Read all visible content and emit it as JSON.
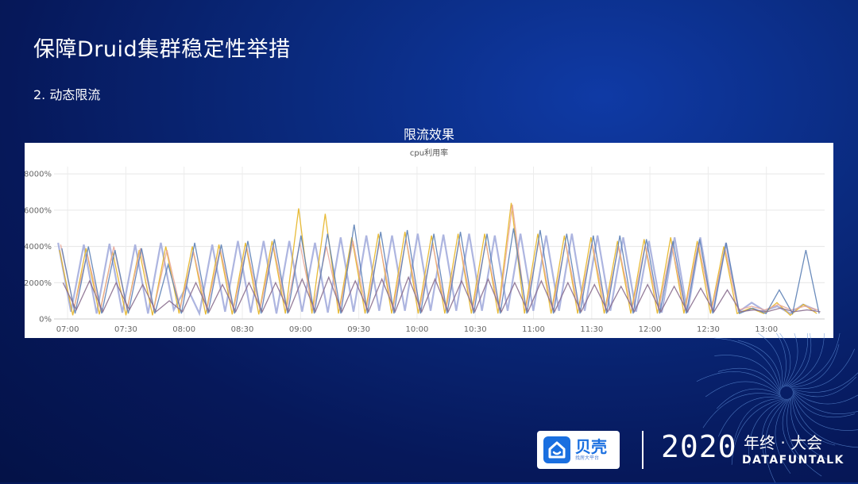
{
  "slide": {
    "title": "保障Druid集群稳定性举措",
    "subtitle": "2. 动态限流"
  },
  "chart_heading": "限流效果",
  "chart_data": {
    "type": "line",
    "title": "cpu利用率",
    "y_ticks": [
      "8000%",
      "6000%",
      "4000%",
      "2000%",
      "0%"
    ],
    "y_tick_values": [
      8000,
      6000,
      4000,
      2000,
      0
    ],
    "ylim": [
      0,
      8400
    ],
    "x_ticks": [
      "07:00",
      "07:30",
      "08:00",
      "08:30",
      "09:00",
      "09:30",
      "10:00",
      "10:30",
      "11:00",
      "11:30",
      "12:00",
      "12:30",
      "13:00"
    ],
    "xlim": [
      "06:53",
      "13:30"
    ],
    "grid": true,
    "series": [
      {
        "color": "#9fa8da",
        "values": [
          4200,
          400,
          4100,
          300,
          4150,
          350,
          4100,
          300,
          4200,
          500,
          1800,
          300,
          4100,
          400,
          4300,
          350,
          4300,
          300,
          4300,
          400,
          4200,
          350,
          4500,
          400,
          4600,
          450,
          4600,
          450,
          4700,
          450,
          4650,
          450,
          4700,
          450,
          4600,
          450,
          4700,
          450,
          4600,
          450,
          4700,
          450,
          4600,
          450,
          4500,
          400,
          4300,
          350,
          4500,
          350,
          4500,
          350,
          4200,
          400,
          900,
          450,
          700,
          300,
          800,
          500
        ]
      },
      {
        "color": "#e6b422",
        "values": [
          3800,
          200,
          3900,
          250,
          3700,
          200,
          3800,
          200,
          4000,
          300,
          4000,
          250,
          4100,
          250,
          4200,
          250,
          4300,
          300,
          6100,
          300,
          5800,
          300,
          4500,
          300,
          4700,
          300,
          4800,
          300,
          4600,
          300,
          4700,
          300,
          4700,
          300,
          6400,
          300,
          4700,
          300,
          4600,
          300,
          4500,
          300,
          4300,
          300,
          4400,
          300,
          4500,
          300,
          4300,
          300,
          4000,
          300,
          600,
          300,
          900,
          200,
          800,
          300
        ]
      },
      {
        "color": "#e8a79a",
        "values": [
          4100,
          600,
          3600,
          500,
          4000,
          500,
          3900,
          500,
          3800,
          600,
          3700,
          500,
          3900,
          500,
          4000,
          500,
          4100,
          500,
          4200,
          500,
          4000,
          500,
          4300,
          500,
          4200,
          500,
          4400,
          500,
          4100,
          500,
          4300,
          500,
          4200,
          500,
          6300,
          500,
          4300,
          500,
          4200,
          500,
          4200,
          500,
          4000,
          500,
          4100,
          500,
          4100,
          500,
          4200,
          500,
          3900,
          500,
          700,
          500,
          800,
          500,
          700,
          500
        ]
      },
      {
        "color": "#5b7fb5",
        "values": [
          3900,
          300,
          4000,
          300,
          3800,
          300,
          3900,
          300,
          3000,
          300,
          4200,
          300,
          4100,
          300,
          4300,
          300,
          4400,
          300,
          4600,
          300,
          4700,
          300,
          5200,
          300,
          4800,
          300,
          4900,
          300,
          4700,
          300,
          4800,
          300,
          4700,
          300,
          5000,
          300,
          4900,
          300,
          4700,
          300,
          4600,
          300,
          4600,
          300,
          4400,
          300,
          4300,
          300,
          4400,
          300,
          4200,
          300,
          600,
          300,
          1600,
          300,
          3800,
          300
        ]
      },
      {
        "color": "#8a6e8e",
        "values": [
          2000,
          500,
          2100,
          400,
          2000,
          500,
          1900,
          400,
          1000,
          400,
          2000,
          400,
          1900,
          400,
          2000,
          400,
          2000,
          400,
          2200,
          400,
          2300,
          400,
          2100,
          400,
          2200,
          400,
          2300,
          400,
          2200,
          400,
          2100,
          400,
          2200,
          400,
          2000,
          400,
          2100,
          400,
          2000,
          400,
          1900,
          400,
          1800,
          400,
          1900,
          400,
          1800,
          400,
          1700,
          400,
          1600,
          400,
          500,
          400,
          600,
          400,
          500,
          400
        ]
      }
    ]
  },
  "brand": {
    "name": "贝壳",
    "tagline": "找房大平台"
  },
  "event": {
    "year": "2020",
    "name": "年终 · 大会",
    "brand": "DATAFUNTALK"
  }
}
